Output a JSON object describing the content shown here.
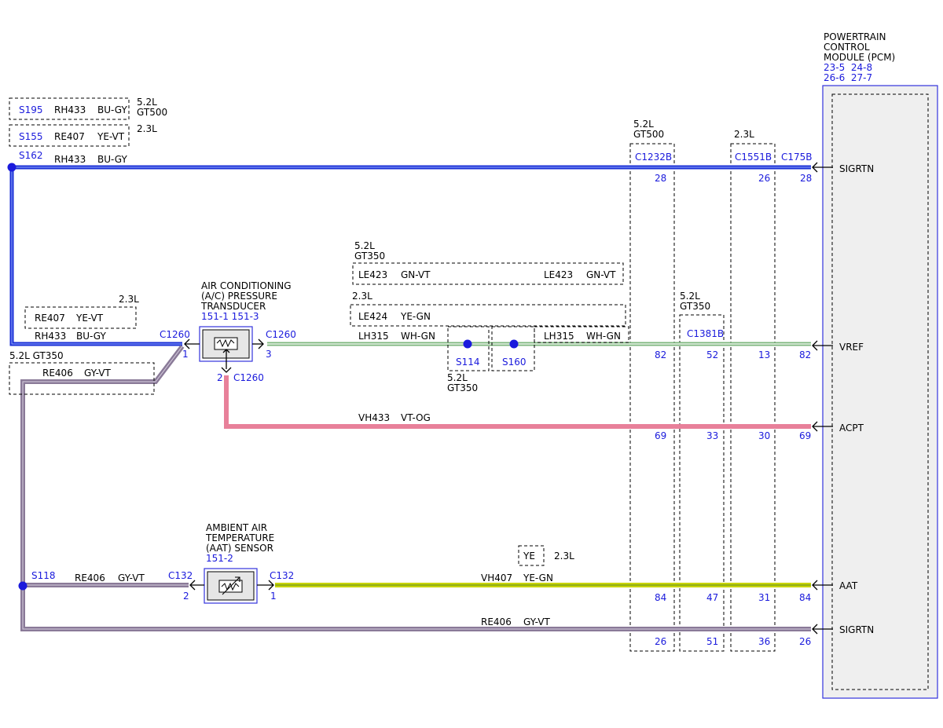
{
  "pcm": {
    "title_lines": [
      "POWERTRAIN",
      "CONTROL",
      "MODULE (PCM)"
    ],
    "ref_lines": [
      "23-5  24-8",
      "26-6  27-7"
    ],
    "pins": [
      "SIGRTN",
      "VREF",
      "ACPT",
      "AAT",
      "SIGRTN"
    ]
  },
  "variant_notes": {
    "s195": {
      "splice": "S195",
      "circuit": "RH433",
      "color": "BU-GY",
      "engine": [
        "5.2L",
        "GT500"
      ]
    },
    "s155": {
      "splice": "S155",
      "circuit": "RE407",
      "color": "YE-VT",
      "engine": [
        "2.3L"
      ]
    },
    "re407_box": {
      "circuit": "RE407",
      "color": "YE-VT",
      "engine": "2.3L"
    },
    "re406_box": {
      "circuit": "RE406",
      "color": "GY-VT",
      "engine": "5.2L GT350"
    },
    "le423_box": {
      "engine": [
        "5.2L",
        "GT350"
      ],
      "left_circuit": "LE423",
      "left_color": "GN-VT",
      "right_circuit": "LE423",
      "right_color": "GN-VT"
    },
    "le424_box": {
      "engine": "2.3L",
      "circuit": "LE424",
      "color": "YE-GN"
    },
    "ye_box": {
      "color": "YE",
      "engine": "2.3L"
    }
  },
  "components": {
    "ac_transducer": {
      "name_lines": [
        "AIR CONDITIONING",
        "(A/C) PRESSURE",
        "TRANSDUCER"
      ],
      "refs": "151-1 151-3"
    },
    "aat_sensor": {
      "name_lines": [
        "AMBIENT AIR",
        "TEMPERATURE",
        "(AAT) SENSOR"
      ],
      "refs": "151-2"
    }
  },
  "splices": {
    "s162": "S162",
    "s114": {
      "id": "S114",
      "engine": [
        "5.2L",
        "GT350"
      ]
    },
    "s160": "S160",
    "s118": "S118"
  },
  "connectors": {
    "c1260": "C1260",
    "c132": "C132",
    "c1232b": {
      "id": "C1232B",
      "engine": [
        "5.2L",
        "GT500"
      ],
      "pins": [
        "28",
        "82",
        "69",
        "84",
        "26"
      ]
    },
    "c1381b": {
      "id": "C1381B",
      "engine": [
        "5.2L",
        "GT350"
      ],
      "pins": [
        "52",
        "33",
        "47",
        "51"
      ]
    },
    "c1551b": {
      "id": "C1551B",
      "engine": [
        "2.3L"
      ],
      "pins": [
        "26",
        "13",
        "30",
        "31",
        "36"
      ]
    },
    "c175b": {
      "id": "C175B",
      "pins": [
        "28",
        "82",
        "69",
        "84",
        "26"
      ]
    }
  },
  "wires": {
    "sigrtn_top": {
      "circuit": "RH433",
      "color": "BU-GY",
      "hex": "#1a2fd6"
    },
    "ac_return": {
      "circuit": "RH433",
      "color": "BU-GY"
    },
    "vref_left": {
      "circuit": "LH315",
      "color": "WH-GN",
      "hex": "#7fb77f"
    },
    "vref_right": {
      "circuit": "LH315",
      "color": "WH-GN"
    },
    "acpt": {
      "circuit": "VH433",
      "color": "VT-OG",
      "hex": "#e8809a"
    },
    "aat_return": {
      "circuit": "RE406",
      "color": "GY-VT",
      "hex": "#8a7a98"
    },
    "aat_signal": {
      "circuit": "VH407",
      "color": "YE-GN",
      "hex": "#c8d400"
    },
    "sigrtn_bottom": {
      "circuit": "RE406",
      "color": "GY-VT"
    }
  },
  "pin_numbers": {
    "ac_1": "1",
    "ac_2": "2",
    "ac_3": "3",
    "aat_1": "1",
    "aat_2": "2"
  },
  "colors": {
    "label_blue": "#1a1adc",
    "frame_blue": "#3333dd"
  }
}
